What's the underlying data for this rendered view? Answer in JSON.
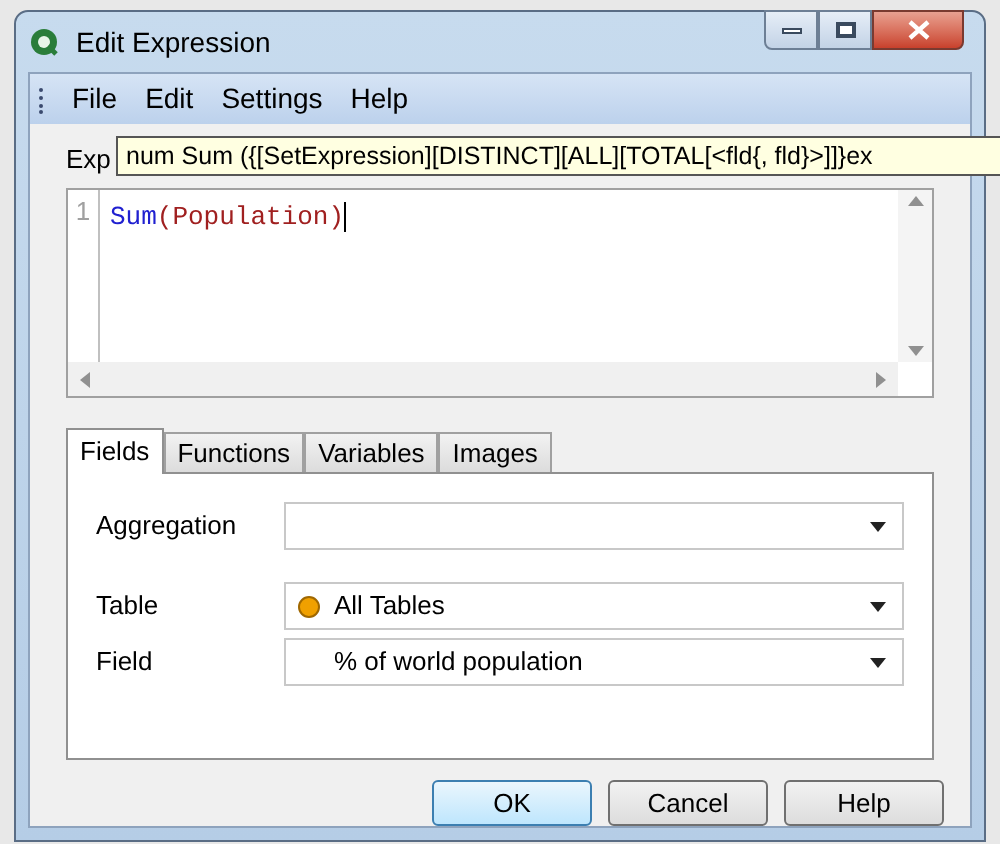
{
  "window": {
    "title": "Edit Expression"
  },
  "menu": [
    "File",
    "Edit",
    "Settings",
    "Help"
  ],
  "expression": {
    "label": "Exp",
    "tooltip": "num Sum ({[SetExpression][DISTINCT][ALL][TOTAL[<fld{, fld}>]]}ex",
    "line_number": "1",
    "tokens": [
      {
        "text": "Sum",
        "kind": "function"
      },
      {
        "text": "(Population)",
        "kind": "field"
      }
    ]
  },
  "tabs": [
    {
      "label": "Fields",
      "selected": true
    },
    {
      "label": "Functions",
      "selected": false
    },
    {
      "label": "Variables",
      "selected": false
    },
    {
      "label": "Images",
      "selected": false
    }
  ],
  "fields": [
    {
      "label": "Aggregation",
      "dot": false
    },
    {
      "label": "Table",
      "value": "All Tables",
      "dot": true
    },
    {
      "label": "Field",
      "value": "% of world population",
      "dot": false
    }
  ],
  "buttons": [
    {
      "label": "OK",
      "selected": true
    },
    {
      "label": "Cancel",
      "selected": false
    },
    {
      "label": "Help",
      "selected": false
    }
  ]
}
